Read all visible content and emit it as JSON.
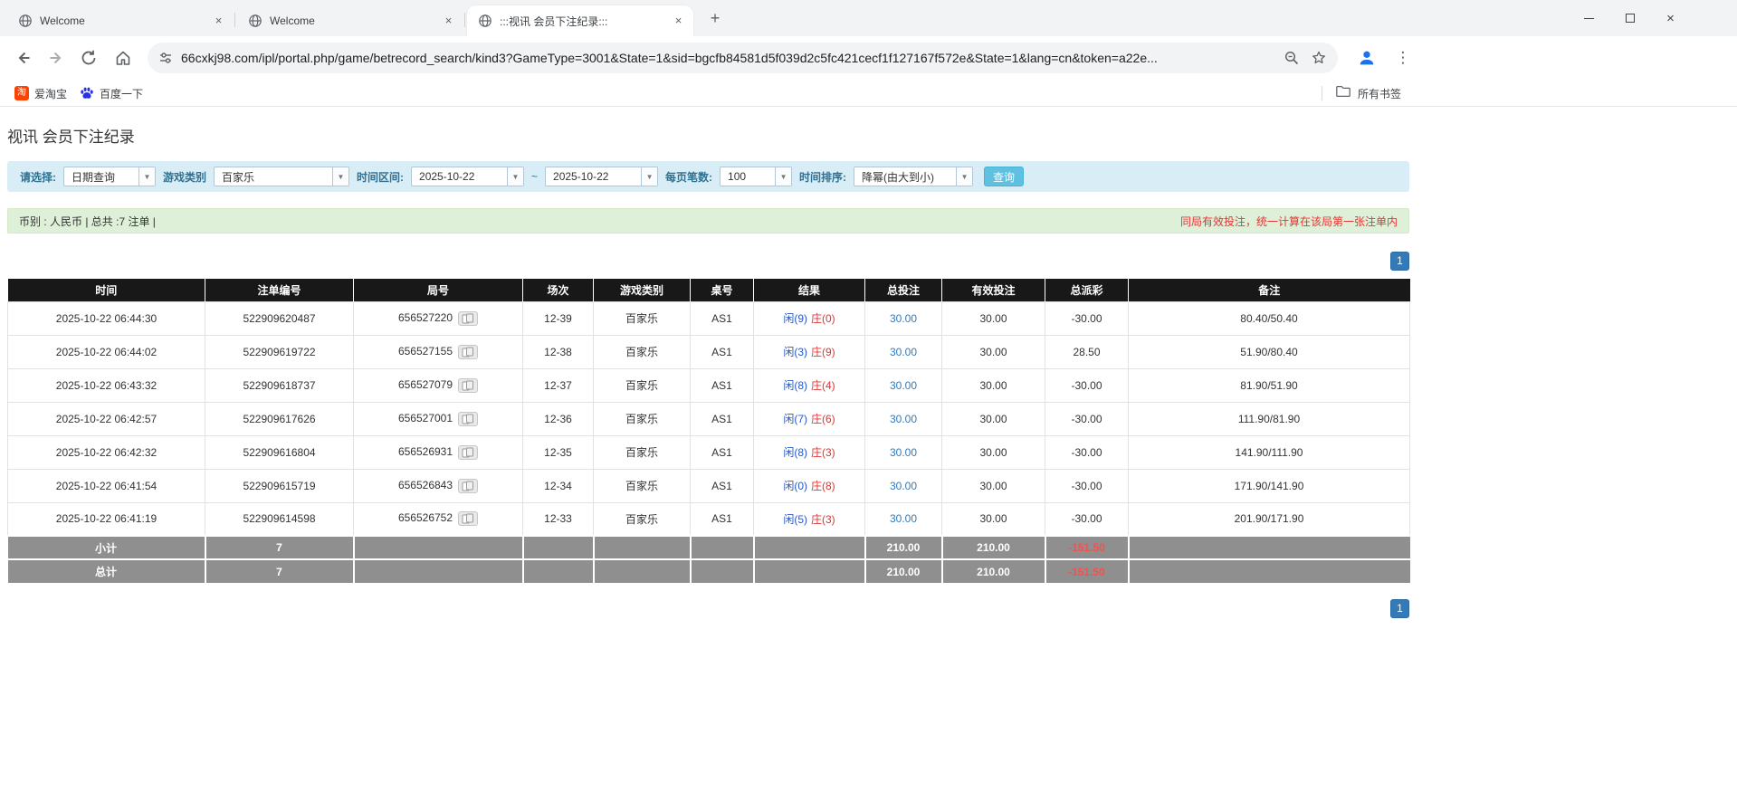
{
  "browser": {
    "tabs": [
      {
        "title": "Welcome"
      },
      {
        "title": "Welcome"
      },
      {
        "title": ":::视讯 会员下注纪录:::"
      }
    ],
    "url": "66cxkj98.com/ipl/portal.php/game/betrecord_search/kind3?GameType=3001&State=1&sid=bgcfb84581d5f039d2c5fc421cecf1f127167f572e&State=1&lang=cn&token=a22e...",
    "bookmarks": [
      {
        "label": "爱淘宝",
        "icon": "taobao-icon"
      },
      {
        "label": "百度一下",
        "icon": "baidu-paw-icon"
      }
    ],
    "all_bookmarks_label": "所有书签"
  },
  "page": {
    "title": "视讯 会员下注纪录",
    "filters": {
      "select_label": "请选择:",
      "select_value": "日期查询",
      "game_type_label": "游戏类别",
      "game_type_value": "百家乐",
      "date_range_label": "时间区间:",
      "date_from": "2025-10-22",
      "range_separator": "~",
      "date_to": "2025-10-22",
      "page_size_label": "每页笔数:",
      "page_size_value": "100",
      "sort_label": "时间排序:",
      "sort_value": "降幂(由大到小)",
      "search_button": "查询"
    },
    "summary_bar": {
      "left": "币别 : 人民币 | 总共 :7 注单 |",
      "right": "同局有效投注，统一计算在该局第一张注单内"
    },
    "pagination": "1",
    "table": {
      "headers": [
        "时间",
        "注单编号",
        "局号",
        "场次",
        "游戏类别",
        "桌号",
        "结果",
        "总投注",
        "有效投注",
        "总派彩",
        "备注"
      ],
      "rows": [
        {
          "time": "2025-10-22 06:44:30",
          "bet_id": "522909620487",
          "round_id": "656527220",
          "session": "12-39",
          "game": "百家乐",
          "table_no": "AS1",
          "result_player": "闲(9)",
          "result_banker": "庄(0)",
          "total_bet": "30.00",
          "valid_bet": "30.00",
          "payout": "-30.00",
          "payout_negative": true,
          "note": "80.40/50.40"
        },
        {
          "time": "2025-10-22 06:44:02",
          "bet_id": "522909619722",
          "round_id": "656527155",
          "session": "12-38",
          "game": "百家乐",
          "table_no": "AS1",
          "result_player": "闲(3)",
          "result_banker": "庄(9)",
          "total_bet": "30.00",
          "valid_bet": "30.00",
          "payout": "28.50",
          "payout_negative": false,
          "note": "51.90/80.40"
        },
        {
          "time": "2025-10-22 06:43:32",
          "bet_id": "522909618737",
          "round_id": "656527079",
          "session": "12-37",
          "game": "百家乐",
          "table_no": "AS1",
          "result_player": "闲(8)",
          "result_banker": "庄(4)",
          "total_bet": "30.00",
          "valid_bet": "30.00",
          "payout": "-30.00",
          "payout_negative": true,
          "note": "81.90/51.90"
        },
        {
          "time": "2025-10-22 06:42:57",
          "bet_id": "522909617626",
          "round_id": "656527001",
          "session": "12-36",
          "game": "百家乐",
          "table_no": "AS1",
          "result_player": "闲(7)",
          "result_banker": "庄(6)",
          "total_bet": "30.00",
          "valid_bet": "30.00",
          "payout": "-30.00",
          "payout_negative": true,
          "note": "111.90/81.90"
        },
        {
          "time": "2025-10-22 06:42:32",
          "bet_id": "522909616804",
          "round_id": "656526931",
          "session": "12-35",
          "game": "百家乐",
          "table_no": "AS1",
          "result_player": "闲(8)",
          "result_banker": "庄(3)",
          "total_bet": "30.00",
          "valid_bet": "30.00",
          "payout": "-30.00",
          "payout_negative": true,
          "note": "141.90/111.90"
        },
        {
          "time": "2025-10-22 06:41:54",
          "bet_id": "522909615719",
          "round_id": "656526843",
          "session": "12-34",
          "game": "百家乐",
          "table_no": "AS1",
          "result_player": "闲(0)",
          "result_banker": "庄(8)",
          "total_bet": "30.00",
          "valid_bet": "30.00",
          "payout": "-30.00",
          "payout_negative": true,
          "note": "171.90/141.90"
        },
        {
          "time": "2025-10-22 06:41:19",
          "bet_id": "522909614598",
          "round_id": "656526752",
          "session": "12-33",
          "game": "百家乐",
          "table_no": "AS1",
          "result_player": "闲(5)",
          "result_banker": "庄(3)",
          "total_bet": "30.00",
          "valid_bet": "30.00",
          "payout": "-30.00",
          "payout_negative": true,
          "note": "201.90/171.90"
        }
      ],
      "footer_rows": [
        {
          "label": "小计",
          "count": "7",
          "total_bet": "210.00",
          "valid_bet": "210.00",
          "payout": "-151.50"
        },
        {
          "label": "总计",
          "count": "7",
          "total_bet": "210.00",
          "valid_bet": "210.00",
          "payout": "-151.50"
        }
      ]
    }
  },
  "colors": {
    "table_header_bg": "#181818",
    "table_footer_bg": "#8f8f8f",
    "link_blue": "#337ab7",
    "negative_red": "#e03333",
    "player_blue": "#2457c5",
    "banker_red": "#e03333",
    "filter_bar_bg": "#d9edf7",
    "summary_bar_bg": "#dff0d8",
    "search_button_bg": "#5fc0e0",
    "pagination_bg": "#337ab7"
  }
}
